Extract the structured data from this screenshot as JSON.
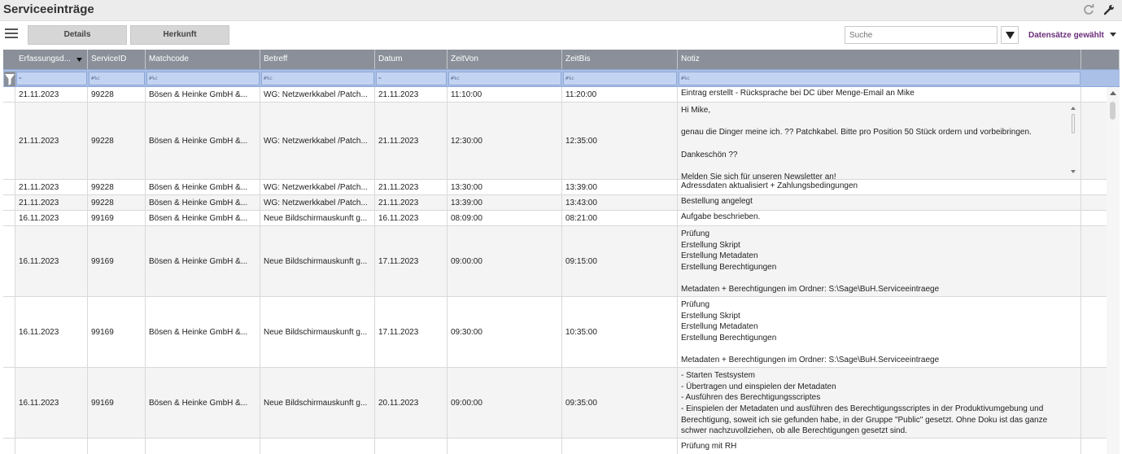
{
  "header": {
    "title": "Serviceeinträge",
    "refresh_icon": "refresh-icon",
    "settings_icon": "wrench-icon"
  },
  "toolbar": {
    "menu_icon": "hamburger-icon",
    "tabs": [
      {
        "label": "Details"
      },
      {
        "label": "Herkunft"
      }
    ],
    "search_placeholder": "Suche",
    "filter_icon": "funnel-dropdown-icon",
    "records_label": "Datensätze gewählt"
  },
  "grid": {
    "columns": [
      {
        "label": "Erfassungsd..."
      },
      {
        "label": "ServiceID"
      },
      {
        "label": "Matchcode"
      },
      {
        "label": "Betreff"
      },
      {
        "label": "Datum"
      },
      {
        "label": "ZeitVon"
      },
      {
        "label": "ZeitBis"
      },
      {
        "label": "Notiz"
      }
    ],
    "filters": [
      "=",
      "#%c",
      "#%c",
      "#%c",
      "=",
      "#%c",
      "#%c",
      "#%c"
    ],
    "rows": [
      {
        "c": [
          "21.11.2023",
          "99228",
          "Bösen & Heinke GmbH &...",
          "WG: Netzwerkkabel /Patch...",
          "21.11.2023",
          "11:10:00",
          "11:20:00"
        ],
        "notiz": [
          "Eintrag erstellt - Rücksprache bei DC über Menge-Email an Mike"
        ]
      },
      {
        "c": [
          "21.11.2023",
          "99228",
          "Bösen & Heinke GmbH &...",
          "WG: Netzwerkkabel /Patch...",
          "21.11.2023",
          "12:30:00",
          "12:35:00"
        ],
        "notiz": [
          "Hi Mike,",
          "",
          "genau die Dinger meine ich. ?? Patchkabel. Bitte pro Position 50 Stück ordern und vorbeibringen.",
          "",
          "Dankeschön ??",
          "",
          "Melden Sie sich für unseren Newsletter an!"
        ]
      },
      {
        "c": [
          "21.11.2023",
          "99228",
          "Bösen & Heinke GmbH &...",
          "WG: Netzwerkkabel /Patch...",
          "21.11.2023",
          "13:30:00",
          "13:39:00"
        ],
        "notiz": [
          "Adressdaten aktualisiert + Zahlungsbedingungen"
        ]
      },
      {
        "c": [
          "21.11.2023",
          "99228",
          "Bösen & Heinke GmbH &...",
          "WG: Netzwerkkabel /Patch...",
          "21.11.2023",
          "13:39:00",
          "13:43:00"
        ],
        "notiz": [
          "Bestellung angelegt"
        ]
      },
      {
        "c": [
          "16.11.2023",
          "99169",
          "Bösen & Heinke GmbH &...",
          "Neue Bildschirmauskunft g...",
          "16.11.2023",
          "08:09:00",
          "08:21:00"
        ],
        "notiz": [
          "Aufgabe beschrieben."
        ]
      },
      {
        "c": [
          "16.11.2023",
          "99169",
          "Bösen & Heinke GmbH &...",
          "Neue Bildschirmauskunft g...",
          "17.11.2023",
          "09:00:00",
          "09:15:00"
        ],
        "notiz": [
          "Prüfung",
          "Erstellung Skript",
          "Erstellung Metadaten",
          "Erstellung Berechtigungen",
          "",
          "Metadaten + Berechtigungen im Ordner: S:\\Sage\\BuH.Serviceeintraege"
        ]
      },
      {
        "c": [
          "16.11.2023",
          "99169",
          "Bösen & Heinke GmbH &...",
          "Neue Bildschirmauskunft g...",
          "17.11.2023",
          "09:30:00",
          "10:35:00"
        ],
        "notiz": [
          "Prüfung",
          "Erstellung Skript",
          "Erstellung Metadaten",
          "Erstellung Berechtigungen",
          "",
          "Metadaten + Berechtigungen im Ordner: S:\\Sage\\BuH.Serviceeintraege"
        ]
      },
      {
        "c": [
          "16.11.2023",
          "99169",
          "Bösen & Heinke GmbH &...",
          "Neue Bildschirmauskunft g...",
          "20.11.2023",
          "09:00:00",
          "09:35:00"
        ],
        "notiz": [
          "- Starten Testsystem",
          "- Übertragen und einspielen der Metadaten",
          "- Ausführen des Berechtigungsscriptes",
          "- Einspielen der Metadaten und ausführen des Berechtigungsscriptes in der Produktivumgebung und",
          "Berechtigung, soweit ich sie gefunden habe, in der Gruppe \"Public\" gesetzt. Ohne Doku ist das ganze",
          "schwer nachzuvollziehen, ob alle Berechtigungen gesetzt sind."
        ]
      },
      {
        "c": [
          "",
          "",
          "",
          "",
          "",
          "",
          ""
        ],
        "notiz": [
          "Prüfung mit RH"
        ]
      }
    ]
  }
}
